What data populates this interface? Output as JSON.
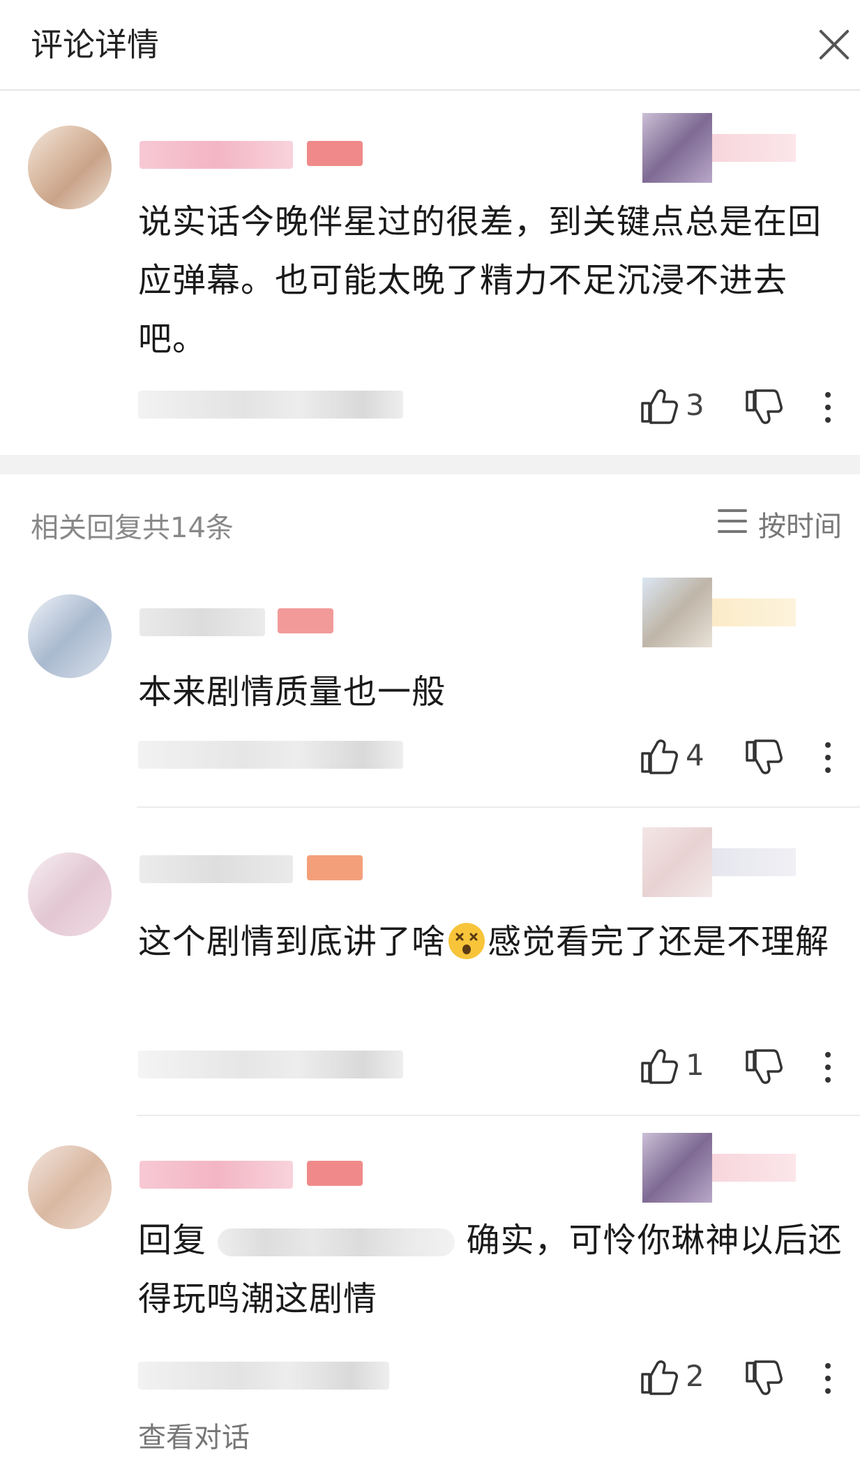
{
  "header": {
    "title": "评论详情"
  },
  "main_comment": {
    "text": "说实话今晚伴星过的很差，到关键点总是在回应弹幕。也可能太晚了精力不足沉浸不进去吧。",
    "likes": "3"
  },
  "replies_header": {
    "count_label": "相关回复共14条",
    "sort_label": "按时间"
  },
  "replies": [
    {
      "text": "本来剧情质量也一般",
      "likes": "4"
    },
    {
      "text_before": "这个剧情到底讲了啥",
      "emoji": "dizzy-face-emoji",
      "text_after": "感觉看完了还是不理解",
      "likes": "1"
    },
    {
      "reply_prefix": "回复",
      "text": "确实，可怜你琳神以后还得玩鸣潮这剧情",
      "likes": "2",
      "view_conversation": "查看对话"
    }
  ],
  "colors": {
    "accent_pink": "#f5a3b5",
    "badge_red": "#f07a7a",
    "badge_orange": "#f3a07a",
    "text_gray": "#888888"
  }
}
